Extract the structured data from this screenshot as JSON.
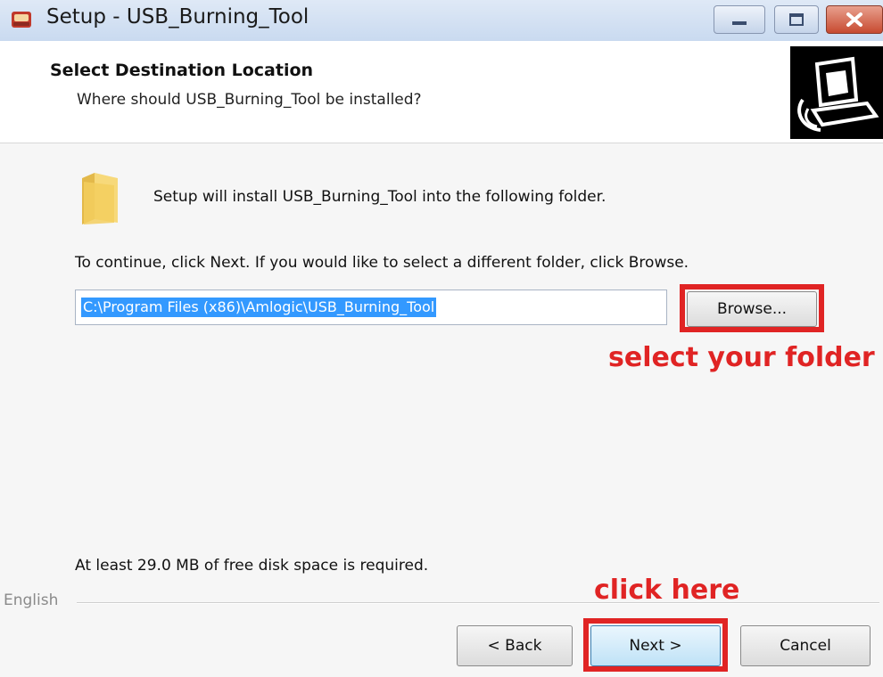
{
  "window": {
    "title": "Setup - USB_Burning_Tool",
    "title_icon": "setup-app-icon",
    "controls": {
      "minimize_icon": "minimize-icon",
      "maximize_icon": "maximize-icon",
      "close_icon": "close-icon",
      "close_color": "#c74a30"
    }
  },
  "header": {
    "title": "Select Destination Location",
    "subtitle": "Where should USB_Burning_Tool be installed?",
    "image_icon": "computer-install-icon"
  },
  "body": {
    "folder_icon": "folder-icon",
    "intro": "Setup will install USB_Burning_Tool into the following folder.",
    "continue_text": "To continue, click Next. If you would like to select a different folder, click Browse.",
    "path_value": "C:\\Program Files (x86)\\Amlogic\\USB_Burning_Tool",
    "browse_label": "Browse...",
    "disk_space": "At least 29.0 MB of free disk space is required."
  },
  "annotations": {
    "select_folder": "select your folder",
    "click_here": "click here",
    "color": "#e02424"
  },
  "footer": {
    "language": "English",
    "back_label": "< Back",
    "next_label": "Next >",
    "cancel_label": "Cancel"
  }
}
